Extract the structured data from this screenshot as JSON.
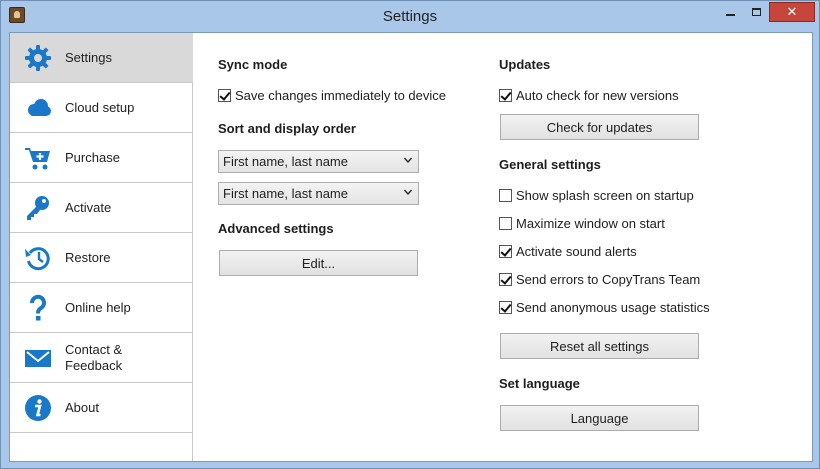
{
  "window": {
    "title": "Settings"
  },
  "sidebar": {
    "items": [
      {
        "label": "Settings",
        "icon": "gear-icon"
      },
      {
        "label": "Cloud setup",
        "icon": "cloud-icon"
      },
      {
        "label": "Purchase",
        "icon": "cart-icon"
      },
      {
        "label": "Activate",
        "icon": "key-icon"
      },
      {
        "label": "Restore",
        "icon": "history-icon"
      },
      {
        "label": "Online help",
        "icon": "question-icon"
      },
      {
        "label": "Contact &\nFeedback",
        "icon": "envelope-icon"
      },
      {
        "label": "About",
        "icon": "info-icon"
      }
    ]
  },
  "left": {
    "sync_heading": "Sync mode",
    "sync_checkbox": "Save changes immediately to device",
    "sort_heading": "Sort and display order",
    "sort_select_1": "First name, last name",
    "sort_select_2": "First name, last name",
    "advanced_heading": "Advanced settings",
    "edit_button": "Edit..."
  },
  "right": {
    "updates_heading": "Updates",
    "auto_check": "Auto check for new versions",
    "check_button": "Check for updates",
    "general_heading": "General settings",
    "options": [
      {
        "label": "Show splash screen on startup",
        "checked": false
      },
      {
        "label": "Maximize window on start",
        "checked": false
      },
      {
        "label": "Activate sound alerts",
        "checked": true
      },
      {
        "label": "Send errors to CopyTrans Team",
        "checked": true
      },
      {
        "label": "Send anonymous usage statistics",
        "checked": true
      }
    ],
    "reset_button": "Reset all settings",
    "language_heading": "Set language",
    "language_button": "Language"
  },
  "colors": {
    "accent": "#1a78c8",
    "close": "#c7463b",
    "active_item": "#d9d9d9"
  }
}
